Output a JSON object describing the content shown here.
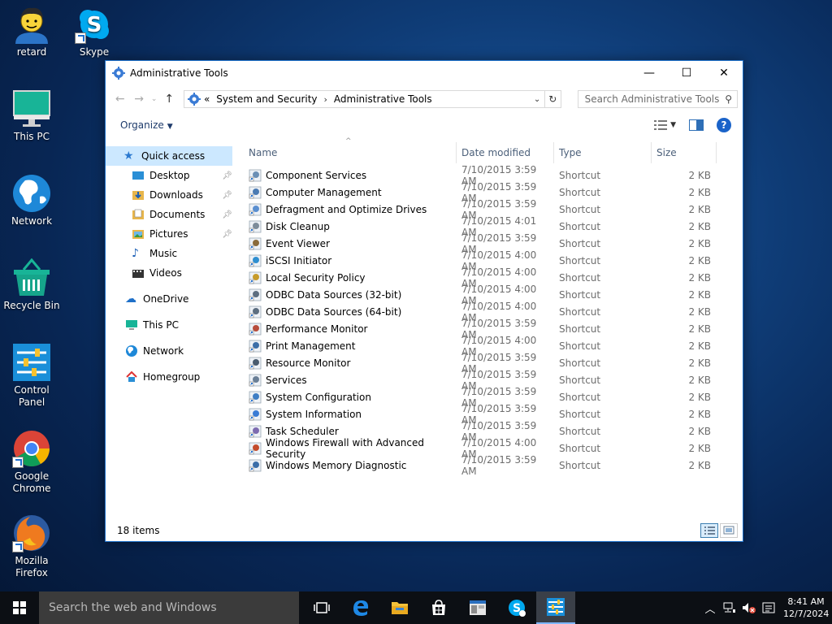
{
  "desktop": {
    "icons": [
      {
        "label": "retard",
        "icon": "user-avatar-icon"
      },
      {
        "label": "Skype",
        "icon": "skype-icon"
      },
      {
        "label": "This PC",
        "icon": "monitor-icon"
      },
      {
        "label": "Network",
        "icon": "globe-icon"
      },
      {
        "label": "Recycle Bin",
        "icon": "recycle-bin-icon"
      },
      {
        "label": "Control Panel",
        "icon": "control-panel-icon"
      },
      {
        "label": "Google Chrome",
        "icon": "chrome-icon"
      },
      {
        "label": "Mozilla Firefox",
        "icon": "firefox-icon"
      }
    ]
  },
  "window": {
    "title": "Administrative Tools",
    "controls": {
      "minimize": "—",
      "maximize": "☐",
      "close": "✕"
    },
    "address": {
      "prefix": "«",
      "crumbs": [
        "System and Security",
        "Administrative Tools"
      ]
    },
    "search_placeholder": "Search Administrative Tools",
    "organize_label": "Organize",
    "help_label": "?",
    "nav": {
      "quick_access": "Quick access",
      "quick_items": [
        "Desktop",
        "Downloads",
        "Documents",
        "Pictures",
        "Music",
        "Videos"
      ],
      "onedrive": "OneDrive",
      "this_pc": "This PC",
      "network": "Network",
      "homegroup": "Homegroup"
    },
    "columns": {
      "name": "Name",
      "date": "Date modified",
      "type": "Type",
      "size": "Size"
    },
    "files": [
      {
        "name": "Component Services",
        "date": "7/10/2015 3:59 AM",
        "type": "Shortcut",
        "size": "2 KB"
      },
      {
        "name": "Computer Management",
        "date": "7/10/2015 3:59 AM",
        "type": "Shortcut",
        "size": "2 KB"
      },
      {
        "name": "Defragment and Optimize Drives",
        "date": "7/10/2015 3:59 AM",
        "type": "Shortcut",
        "size": "2 KB"
      },
      {
        "name": "Disk Cleanup",
        "date": "7/10/2015 4:01 AM",
        "type": "Shortcut",
        "size": "2 KB"
      },
      {
        "name": "Event Viewer",
        "date": "7/10/2015 3:59 AM",
        "type": "Shortcut",
        "size": "2 KB"
      },
      {
        "name": "iSCSI Initiator",
        "date": "7/10/2015 4:00 AM",
        "type": "Shortcut",
        "size": "2 KB"
      },
      {
        "name": "Local Security Policy",
        "date": "7/10/2015 4:00 AM",
        "type": "Shortcut",
        "size": "2 KB"
      },
      {
        "name": "ODBC Data Sources (32-bit)",
        "date": "7/10/2015 4:00 AM",
        "type": "Shortcut",
        "size": "2 KB"
      },
      {
        "name": "ODBC Data Sources (64-bit)",
        "date": "7/10/2015 4:00 AM",
        "type": "Shortcut",
        "size": "2 KB"
      },
      {
        "name": "Performance Monitor",
        "date": "7/10/2015 3:59 AM",
        "type": "Shortcut",
        "size": "2 KB"
      },
      {
        "name": "Print Management",
        "date": "7/10/2015 4:00 AM",
        "type": "Shortcut",
        "size": "2 KB"
      },
      {
        "name": "Resource Monitor",
        "date": "7/10/2015 3:59 AM",
        "type": "Shortcut",
        "size": "2 KB"
      },
      {
        "name": "Services",
        "date": "7/10/2015 3:59 AM",
        "type": "Shortcut",
        "size": "2 KB"
      },
      {
        "name": "System Configuration",
        "date": "7/10/2015 3:59 AM",
        "type": "Shortcut",
        "size": "2 KB"
      },
      {
        "name": "System Information",
        "date": "7/10/2015 3:59 AM",
        "type": "Shortcut",
        "size": "2 KB"
      },
      {
        "name": "Task Scheduler",
        "date": "7/10/2015 3:59 AM",
        "type": "Shortcut",
        "size": "2 KB"
      },
      {
        "name": "Windows Firewall with Advanced Security",
        "date": "7/10/2015 4:00 AM",
        "type": "Shortcut",
        "size": "2 KB"
      },
      {
        "name": "Windows Memory Diagnostic",
        "date": "7/10/2015 3:59 AM",
        "type": "Shortcut",
        "size": "2 KB"
      }
    ],
    "status": "18 items"
  },
  "taskbar": {
    "search_placeholder": "Search the web and Windows",
    "apps": [
      "task-view-icon",
      "edge-icon",
      "file-explorer-icon",
      "store-icon",
      "app-window-icon",
      "skype-icon",
      "control-panel-icon"
    ],
    "clock_time": "8:41 AM",
    "clock_date": "12/7/2024"
  },
  "colors": {
    "accent": "#1e70c8",
    "selection": "#cce8ff"
  }
}
